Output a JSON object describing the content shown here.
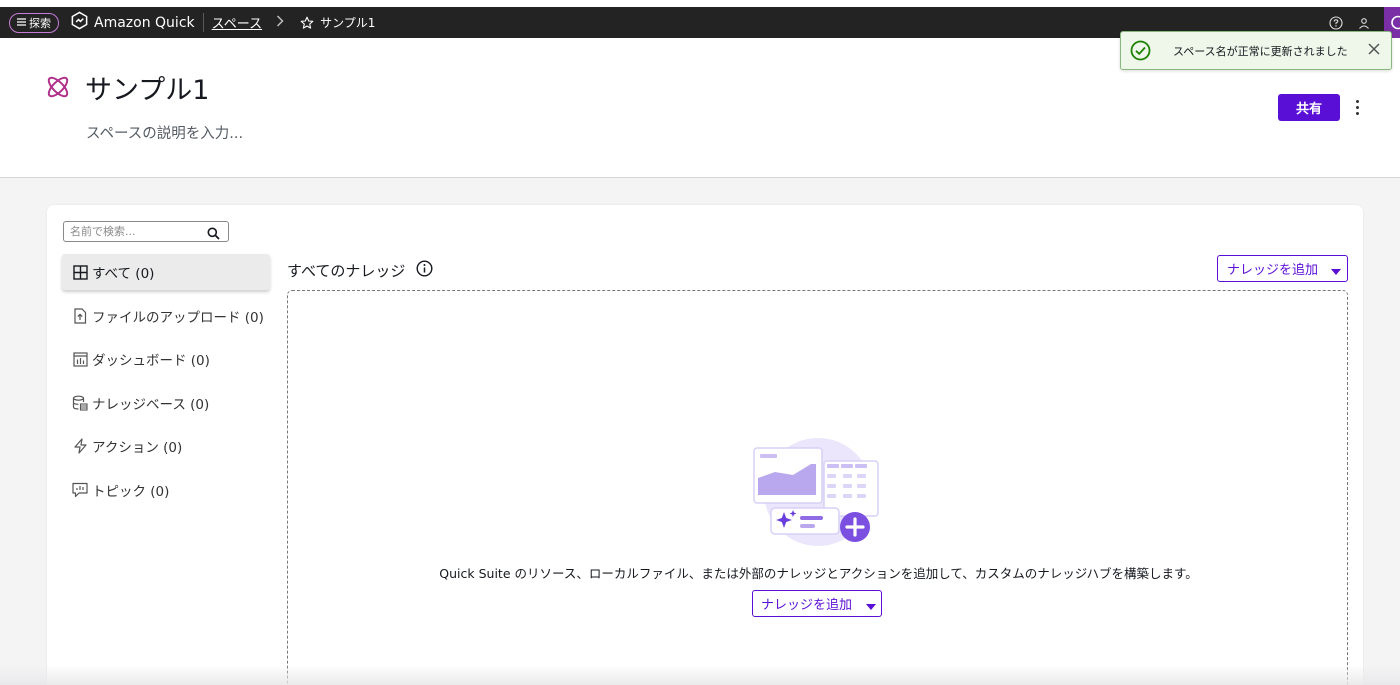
{
  "topbar": {
    "explore_label": "探索",
    "app_name": "Amazon Quick",
    "breadcrumb_spaces": "スペース",
    "breadcrumb_current": "サンプル1"
  },
  "toast": {
    "message": "スペース名が正常に更新されました"
  },
  "header": {
    "title": "サンプル1",
    "description_placeholder": "スペースの説明を入力...",
    "share_label": "共有"
  },
  "search": {
    "placeholder": "名前で検索..."
  },
  "nav": {
    "items": [
      {
        "label": "すべて (0)",
        "icon": "grid-icon",
        "active": true
      },
      {
        "label": "ファイルのアップロード (0)",
        "icon": "file-upload-icon"
      },
      {
        "label": "ダッシュボード (0)",
        "icon": "dashboard-icon"
      },
      {
        "label": "ナレッジベース (0)",
        "icon": "database-icon"
      },
      {
        "label": "アクション (0)",
        "icon": "lightning-icon"
      },
      {
        "label": "トピック (0)",
        "icon": "topic-icon"
      }
    ]
  },
  "main": {
    "section_title": "すべてのナレッジ",
    "add_knowledge_label": "ナレッジを追加",
    "empty_message": "Quick Suite のリソース、ローカルファイル、または外部のナレッジとアクションを追加して、カスタムのナレッジハブを構築します。",
    "empty_add_label": "ナレッジを追加"
  },
  "colors": {
    "accent": "#5a0fd6",
    "topbar_bg": "#232323",
    "toast_bg": "#eef7ea",
    "success": "#1d8102",
    "space_icon": "#b0308a"
  }
}
